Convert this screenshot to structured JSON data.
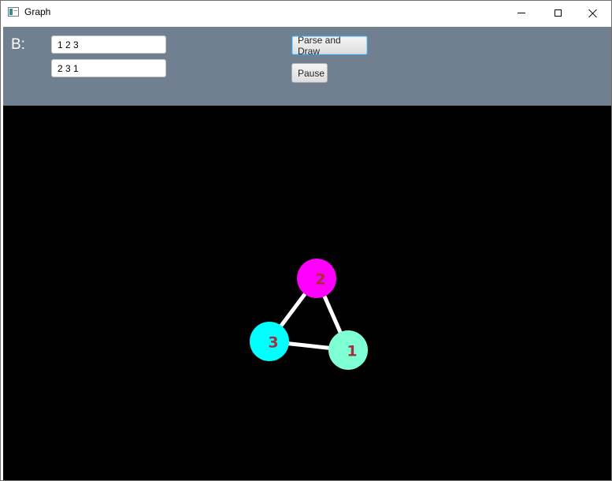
{
  "window": {
    "title": "Graph",
    "icon": "app-window-icon"
  },
  "controls": {
    "b_label": "B:",
    "row1_value": "1 2 3",
    "row2_value": "2 3 1",
    "parse_button": "Parse and Draw",
    "pause_button": "Pause"
  },
  "colors": {
    "toolbar_bg": "#708090",
    "canvas_bg": "#000000",
    "edge": "#ffffff",
    "label": "#a0303a"
  },
  "graph": {
    "nodes": [
      {
        "id": "1",
        "label": "1",
        "color": "#7fffd4"
      },
      {
        "id": "2",
        "label": "2",
        "color": "#ff00ff"
      },
      {
        "id": "3",
        "label": "3",
        "color": "#00ffff"
      }
    ],
    "edges": [
      {
        "from": "1",
        "to": "2"
      },
      {
        "from": "2",
        "to": "3"
      },
      {
        "from": "3",
        "to": "1"
      }
    ]
  }
}
